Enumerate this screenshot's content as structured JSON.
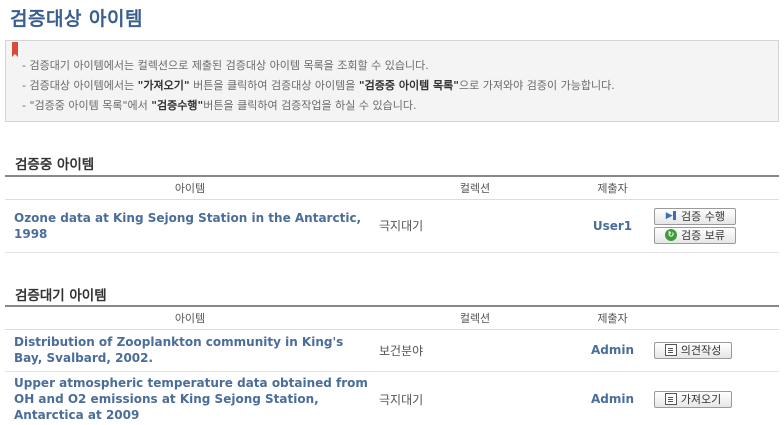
{
  "page": {
    "title": "검증대상 아이템"
  },
  "notice": {
    "line1": "- 검증대기 아이템에서는 컬렉션으로 제출된 검증대상 아이템 목록을 조회할 수 있습니다.",
    "line2": {
      "pre": "- 검증대상 아이템에서는 ",
      "b1": "\"가져오기\"",
      "mid": " 버튼을 클릭하여 검증대상 아이템을 ",
      "b2": "\"검증중 아이템 목록\"",
      "post": "으로 가져와야 검증이 가능합니다."
    },
    "line3": {
      "pre": "- \"검증중 아이템 목록\"에서 ",
      "b1": "\"검증수행\"",
      "post": "버튼을 클릭하여 검증작업을 하실 수 있습니다."
    }
  },
  "in_progress": {
    "title": "검증중 아이템",
    "headers": {
      "item": "아이템",
      "collection": "컬렉션",
      "submitter": "제출자"
    },
    "rows": [
      {
        "item": "Ozone data at King Sejong Station in the Antarctic, 1998",
        "collection": "극지대기",
        "submitter": "User1",
        "btn_run": "검증 수행",
        "btn_hold": "검증 보류"
      }
    ]
  },
  "waiting": {
    "title": "검증대기 아이템",
    "headers": {
      "item": "아이템",
      "collection": "컬렉션",
      "submitter": "제출자"
    },
    "rows": [
      {
        "item": "Distribution of Zooplankton community in King's Bay, Svalbard, 2002.",
        "collection": "보건분야",
        "submitter": "Admin",
        "btn": "의견작성"
      },
      {
        "item": "Upper atmospheric temperature data obtained from OH and O2 emissions at King Sejong Station, Antarctica at 2009",
        "collection": "극지대기",
        "submitter": "Admin",
        "btn": "가져오기"
      }
    ]
  },
  "icons": {
    "notice_flag": "bookmark-flag-icon",
    "run": "play-pause-icon",
    "hold": "refresh-circle-icon",
    "opinion": "document-edit-icon",
    "import": "document-import-icon"
  }
}
